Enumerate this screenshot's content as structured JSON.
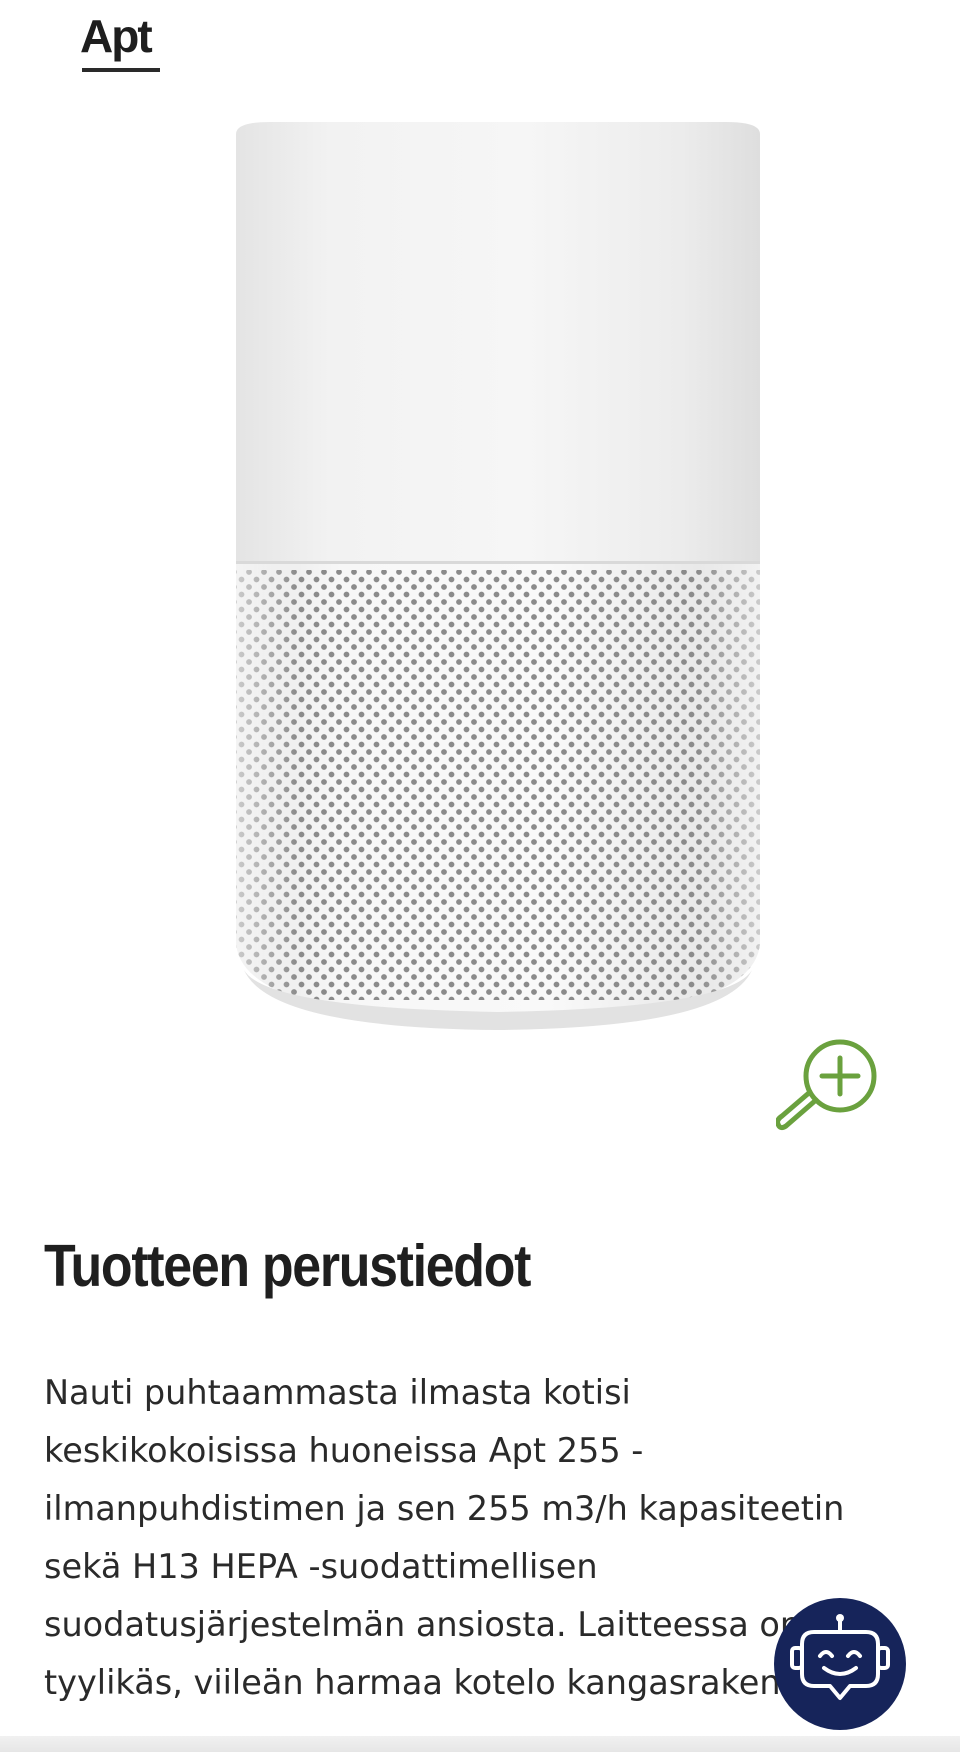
{
  "brand": {
    "name": "Apt"
  },
  "product": {
    "image_icon": "air-purifier-product-image",
    "zoom_icon": "zoom-in-icon",
    "zoom_color": "#6aa13e"
  },
  "section": {
    "title": "Tuotteen perustiedot",
    "description_lines": [
      "Nauti puhtaammasta ilmasta kotisi",
      "keskikokoisissa huoneissa Apt 255 -",
      "ilmanpuhdistimen ja sen 255 m3/h kapasiteetin",
      "sekä H13 HEPA -suodattimellisen",
      "suodatusjärjestelmän ansiosta. Laitteessa on",
      "tyylikäs, viileän harmaa kotelo kangasrakenteella."
    ]
  },
  "chat_assistant": {
    "icon": "chatbot-robot-icon",
    "background_color": "#16245a"
  }
}
